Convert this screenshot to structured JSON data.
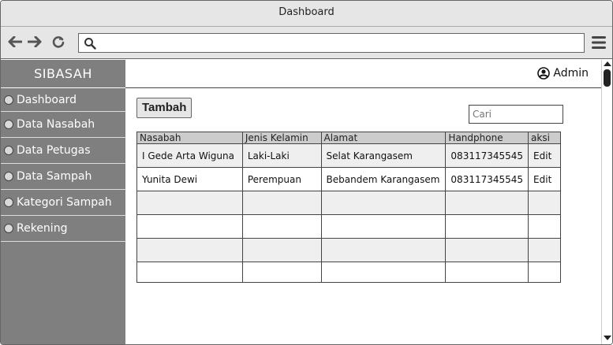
{
  "window": {
    "title": "Dashboard"
  },
  "browser": {
    "back_icon": "arrow-left-icon",
    "forward_icon": "arrow-right-icon",
    "reload_icon": "reload-icon",
    "search_icon": "search-icon",
    "menu_icon": "hamburger-menu-icon",
    "address_value": ""
  },
  "sidebar": {
    "brand": "SIBASAH",
    "items": [
      {
        "label": "Dashboard"
      },
      {
        "label": "Data Nasabah"
      },
      {
        "label": "Data Petugas"
      },
      {
        "label": "Data Sampah"
      },
      {
        "label": "Kategori Sampah"
      },
      {
        "label": "Rekening"
      }
    ]
  },
  "header": {
    "user_label": "Admin",
    "user_icon": "user-avatar-icon"
  },
  "main": {
    "add_button": "Tambah",
    "search_placeholder": "Cari"
  },
  "table": {
    "columns": [
      "Nasabah",
      "Jenis Kelamin",
      "Alamat",
      "Handphone",
      "aksi"
    ],
    "rows": [
      [
        "I Gede Arta Wiguna",
        "Laki-Laki",
        "Selat Karangasem",
        "083117345545",
        "Edit"
      ],
      [
        "Yunita Dewi",
        "Perempuan",
        "Bebandem Karangasem",
        "083117345545",
        "Edit"
      ],
      [
        "",
        "",
        "",
        "",
        ""
      ],
      [
        "",
        "",
        "",
        "",
        ""
      ],
      [
        "",
        "",
        "",
        "",
        ""
      ],
      [
        "",
        "",
        "",
        "",
        ""
      ]
    ]
  },
  "colors": {
    "sidebar_bg": "#7f7f7f",
    "chrome_bg": "#e6e6e6",
    "header_row_bg": "#cccccc",
    "stripe_bg": "#efefef"
  }
}
